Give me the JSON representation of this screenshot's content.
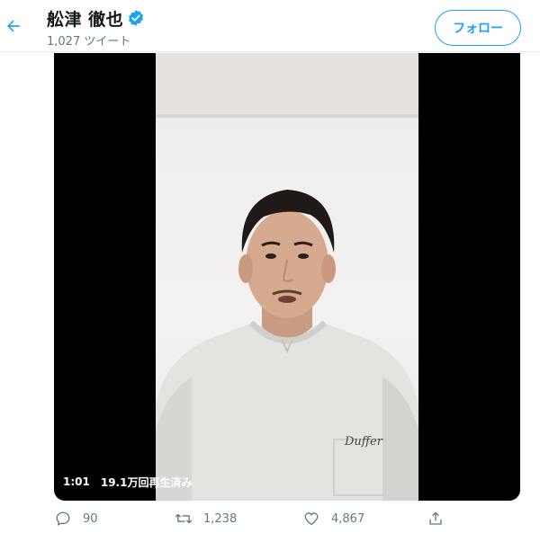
{
  "header": {
    "display_name": "舩津 徹也",
    "tweet_count": "1,027 ツイート",
    "follow_label": "フォロー",
    "back_icon": "arrow-left-icon",
    "verified_icon": "verified-badge-icon"
  },
  "video": {
    "duration": "1:01",
    "views": "19.1万回再生済み",
    "shirt_text": "Duffer"
  },
  "actions": {
    "reply_count": "90",
    "retweet_count": "1,238",
    "like_count": "4,867"
  },
  "colors": {
    "accent": "#1da1f2",
    "muted": "#657786",
    "text": "#14171a"
  }
}
